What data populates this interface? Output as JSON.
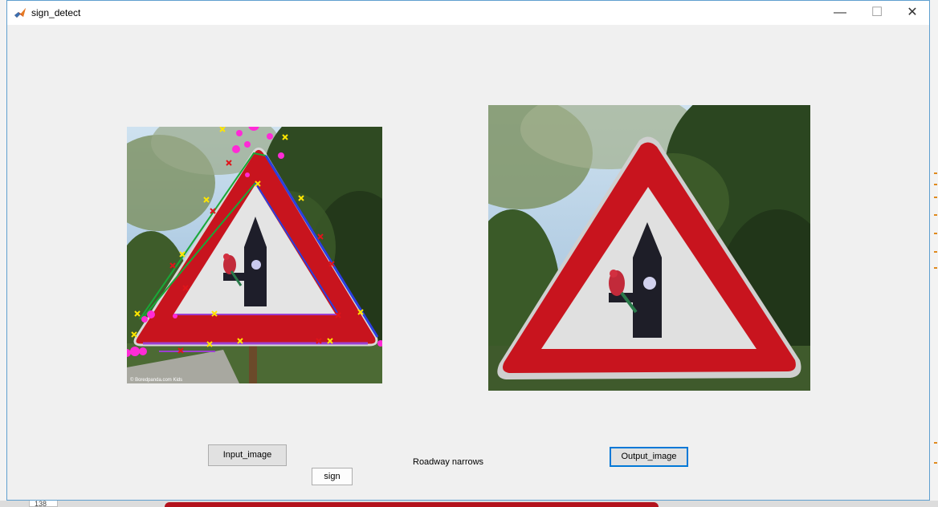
{
  "window": {
    "title": "sign_detect",
    "minimize_symbol": "—",
    "maximize_symbol": "☐",
    "close_symbol": "✕"
  },
  "buttons": {
    "input_label": "Input_image",
    "output_label": "Output_image",
    "sign_label": "sign"
  },
  "result": {
    "text": "Roadway narrows"
  },
  "input_image": {
    "watermark": "© Boredpanda.com Kids"
  },
  "background": {
    "bottom_number": "138"
  },
  "colors": {
    "sign_red": "#c8141e",
    "sign_white": "#e6e6e6",
    "edge_green": "#1aa838",
    "edge_blue": "#2a3fe0",
    "edge_purple": "#9b3fd0",
    "marker_magenta": "#ff2bd6",
    "marker_yellow": "#ffe600",
    "marker_red": "#e0141a",
    "focus_blue": "#0078d7"
  },
  "icons": {
    "app": "matlab-icon"
  }
}
